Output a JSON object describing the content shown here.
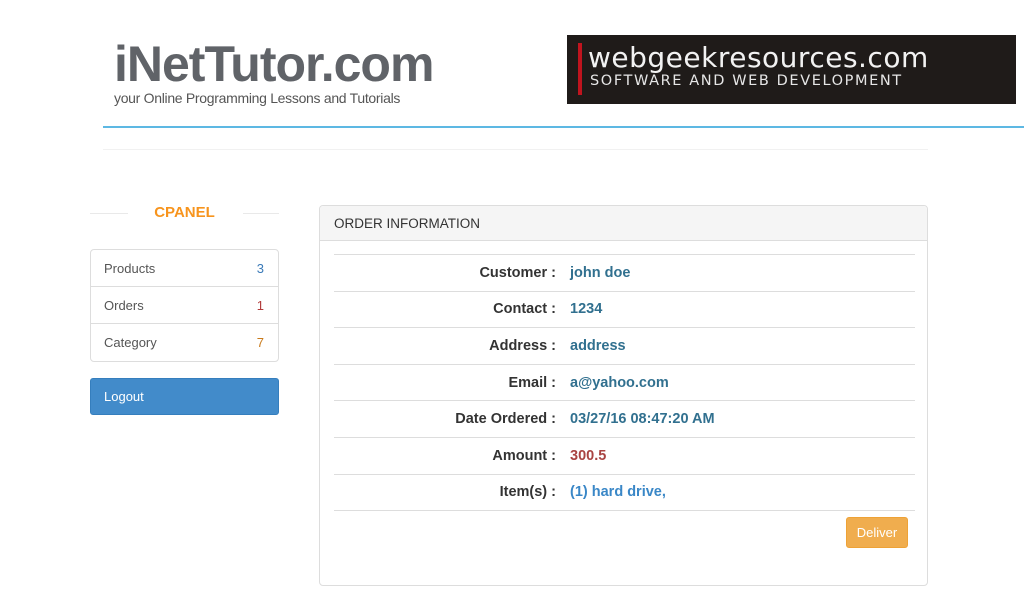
{
  "header": {
    "logo_title": "iNetTutor.com",
    "logo_subtitle": "your Online Programming Lessons and Tutorials",
    "banner_title": "webgeekresources.com",
    "banner_subtitle": "SOFTWARE AND WEB DEVELOPMENT"
  },
  "sidebar": {
    "title": "CPANEL",
    "items": [
      {
        "label": "Products",
        "count": "3"
      },
      {
        "label": "Orders",
        "count": "1"
      },
      {
        "label": "Category",
        "count": "7"
      }
    ],
    "logout_label": "Logout"
  },
  "order": {
    "heading": "ORDER INFORMATION",
    "rows": [
      {
        "label": "Customer :",
        "value": "john doe"
      },
      {
        "label": "Contact :",
        "value": "1234"
      },
      {
        "label": "Address :",
        "value": "address"
      },
      {
        "label": "Email :",
        "value": "a@yahoo.com"
      },
      {
        "label": "Date Ordered :",
        "value": "03/27/16 08:47:20 AM"
      },
      {
        "label": "Amount :",
        "value": "300.5"
      },
      {
        "label": "Item(s) :",
        "value": "(1) hard drive,"
      }
    ],
    "deliver_label": "Deliver"
  },
  "colors": {
    "accent_blue": "#428bca",
    "header_line": "#5db8e3",
    "cpanel_orange": "#f7941d",
    "deliver_orange": "#f0ad4e",
    "value_blue": "#31708f",
    "amount_red": "#a94442"
  }
}
